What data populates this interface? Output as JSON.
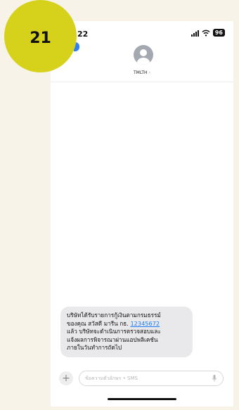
{
  "badge": {
    "number": "21"
  },
  "status_bar": {
    "time": "22",
    "battery": "96"
  },
  "header": {
    "contact_name": "TMLTH",
    "chevron": "›"
  },
  "message": {
    "line1": "บริษัทได้รับรายการกู้เงินตามกรมธรรม์",
    "line2_prefix": "ของคุณ สวัสดี มารีน กธ. ",
    "policy_number": "12345672",
    "line3": "แล้ว บริษัทจะดำเนินการตรวจสอบและ",
    "line4": "แจ้งผลการพิจารณาผ่านแอปพลิเคชัน",
    "line5": "ภายในวันทำการถัดไป"
  },
  "composer": {
    "placeholder": "ข้อความตัวอักษร • SMS",
    "plus": "+"
  },
  "colors": {
    "badge": "#d6d21b",
    "link": "#1a7cf5",
    "bubble": "#e9e9eb",
    "background": "#f7f3e8"
  }
}
